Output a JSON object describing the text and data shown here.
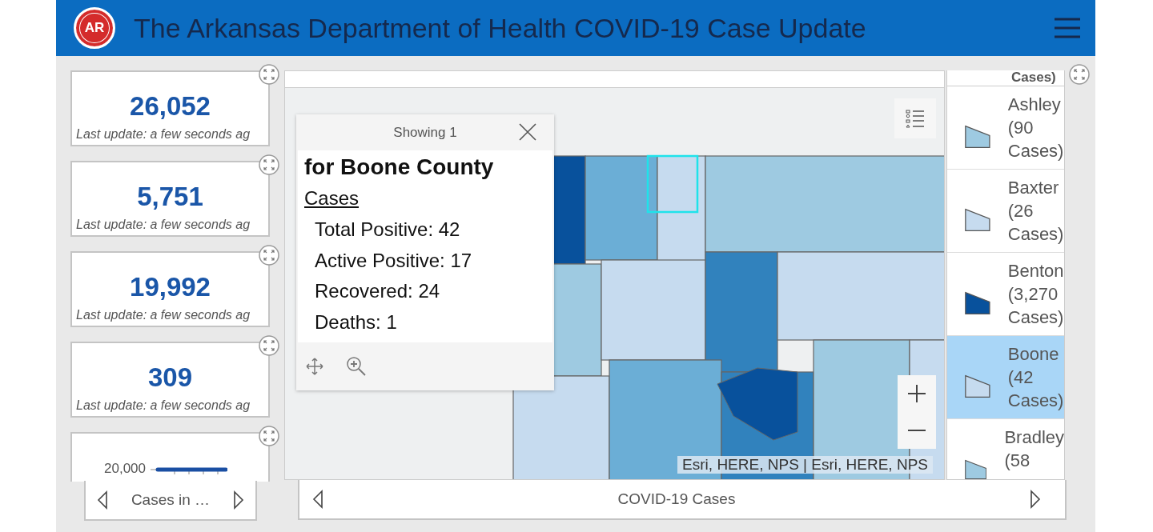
{
  "header": {
    "logo_text": "AR",
    "title": "The Arkansas Department of Health COVID-19 Case Update"
  },
  "indicators": [
    {
      "value": "26,052",
      "note": "Last update: a few seconds ag"
    },
    {
      "value": "5,751",
      "note": "Last update: a few seconds ag"
    },
    {
      "value": "19,992",
      "note": "Last update: a few seconds ag"
    },
    {
      "value": "309",
      "note": "Last update: a few seconds ag"
    }
  ],
  "chart_card": {
    "axis_label": "20,000"
  },
  "chart_nav": {
    "label": "Cases in …"
  },
  "map": {
    "popup": {
      "header": "Showing 1",
      "title": "for Boone County",
      "section": "Cases",
      "lines": [
        "Total Positive: 42",
        "Active Positive: 17",
        "Recovered: 24",
        "Deaths: 1"
      ]
    },
    "attribution": "Esri, HERE, NPS | Esri, HERE, NPS"
  },
  "legend": {
    "fragment": "Cases)",
    "items": [
      {
        "label": "Ashley (90 Cases)",
        "color": "#9ecae1",
        "selected": false
      },
      {
        "label": "Baxter (26 Cases)",
        "color": "#c6dbef",
        "selected": false
      },
      {
        "label": "Benton (3,270 Cases)",
        "color": "#08519c",
        "selected": false
      },
      {
        "label": "Boone (42 Cases)",
        "color": "#c6dbef",
        "selected": true
      },
      {
        "label": "Bradley (58",
        "color": "#9ecae1",
        "selected": false
      }
    ]
  },
  "footer": {
    "label": "COVID-19 Cases"
  }
}
